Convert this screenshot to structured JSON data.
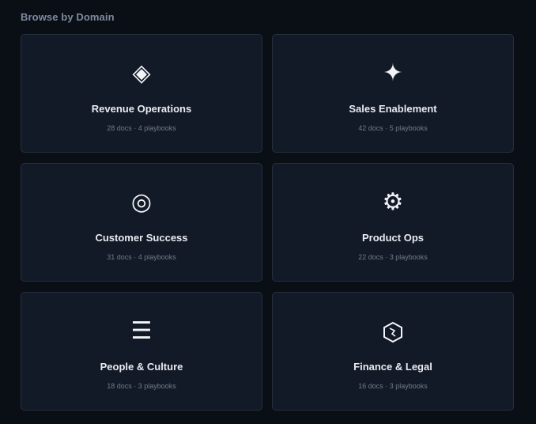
{
  "section": {
    "title": "Browse by Domain"
  },
  "domains": [
    {
      "icon": "diamond-icon",
      "glyph": "◈",
      "title": "Revenue Operations",
      "meta": "28 docs · 4 playbooks"
    },
    {
      "icon": "sparkle-icon",
      "glyph": "✦",
      "title": "Sales Enablement",
      "meta": "42 docs · 5 playbooks"
    },
    {
      "icon": "target-icon",
      "glyph": "◎",
      "title": "Customer Success",
      "meta": "31 docs · 4 playbooks"
    },
    {
      "icon": "gear-icon",
      "glyph": "⚙",
      "title": "Product Ops",
      "meta": "22 docs · 3 playbooks"
    },
    {
      "icon": "menu-lines-icon",
      "glyph": "☰",
      "title": "People & Culture",
      "meta": "18 docs · 3 playbooks"
    },
    {
      "icon": "hexagon-icon",
      "glyph": "",
      "title": "Finance & Legal",
      "meta": "16 docs · 3 playbooks"
    }
  ],
  "colors": {
    "background": "#0a0e15",
    "card": "#131a27",
    "card_border": "#262f3e",
    "title_text": "#e8ebf1",
    "meta_text": "#6f7a8d",
    "section_title": "#7f8aa0"
  }
}
